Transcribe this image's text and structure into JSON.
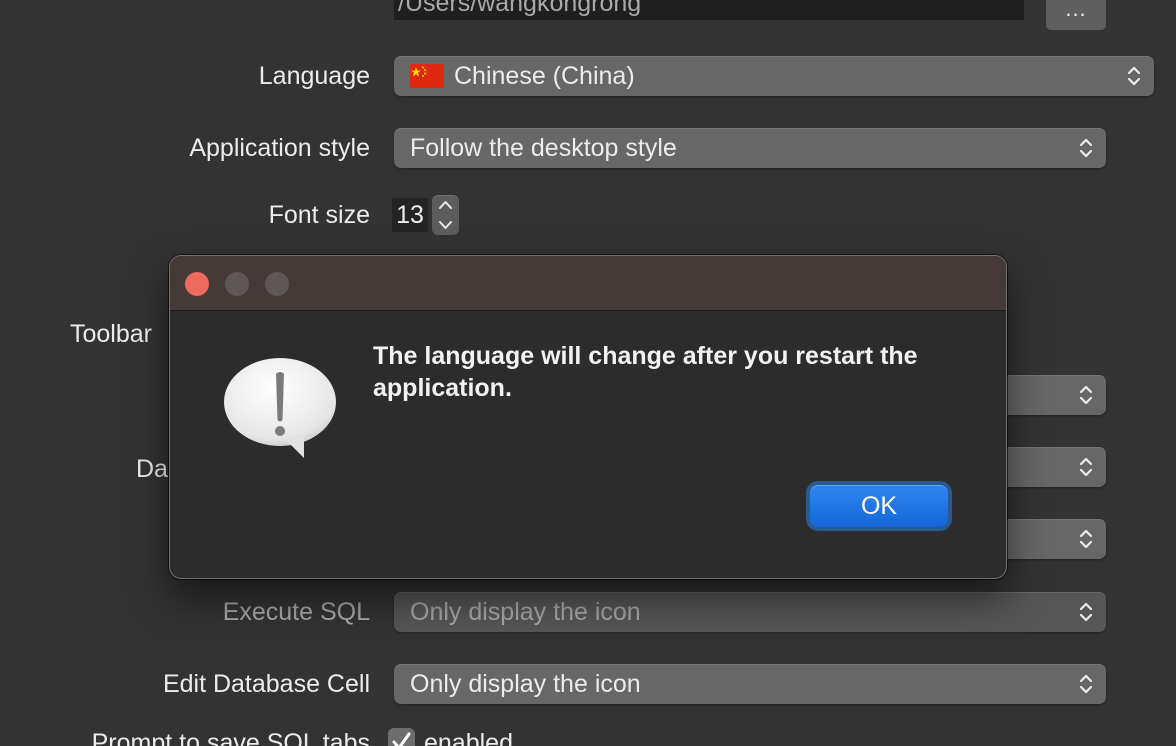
{
  "settings": {
    "path_value": "/Users/wangkongrong",
    "more_button_label": "...",
    "language": {
      "label": "Language",
      "value": "Chinese (China)",
      "flag": "china-flag-icon"
    },
    "application_style": {
      "label": "Application style",
      "value": "Follow the desktop style"
    },
    "font_size": {
      "label": "Font size",
      "value": "13"
    },
    "toolbar_label": "Toolbar",
    "partial_label_da": "Da",
    "execute_sql": {
      "label": "Execute SQL",
      "value": "Only display the icon"
    },
    "edit_database_cell": {
      "label": "Edit Database Cell",
      "value": "Only display the icon"
    },
    "prompt_save_sql_tabs": {
      "label": "Prompt to save SQL tabs",
      "checkbox_label": "enabled",
      "checked": true
    }
  },
  "dialog": {
    "message": "The language will change after you restart the application.",
    "ok_label": "OK",
    "icon": "alert-caution-icon"
  },
  "colors": {
    "background": "#333333",
    "accent_button": "#1f78e8",
    "close_traffic": "#ec6a5e",
    "inactive_traffic": "#5e5655"
  }
}
